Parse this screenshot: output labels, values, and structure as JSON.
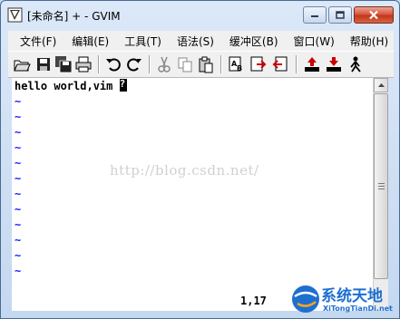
{
  "window": {
    "title": "[未命名] + - GVIM",
    "caption_buttons": [
      "minimize",
      "maximize",
      "close"
    ]
  },
  "menu": {
    "items": [
      {
        "label": "文件(F)"
      },
      {
        "label": "编辑(E)"
      },
      {
        "label": "工具(T)"
      },
      {
        "label": "语法(S)"
      },
      {
        "label": "缓冲区(B)"
      },
      {
        "label": "窗口(W)"
      },
      {
        "label": "帮助(H)"
      }
    ]
  },
  "toolbar": {
    "buttons": [
      "open-icon",
      "save-icon",
      "save-all-icon",
      "print-icon",
      "undo-icon",
      "redo-icon",
      "cut-icon",
      "copy-icon",
      "paste-icon",
      "find-icon",
      "find-next-icon",
      "find-prev-icon",
      "load-session-icon",
      "save-session-icon",
      "run-script-icon"
    ]
  },
  "editor": {
    "line1": "hello world,vim ",
    "cursor_char": "?",
    "tilde": "~",
    "tilde_count": 12,
    "ruler": "1,17"
  },
  "watermark": {
    "text": "http://blog.csdn.net/"
  },
  "logo": {
    "name": "系统天地",
    "sub": "XiTongTianDi.net"
  },
  "colors": {
    "tilde": "#1a1aff",
    "logo": "#1e6fd0"
  }
}
